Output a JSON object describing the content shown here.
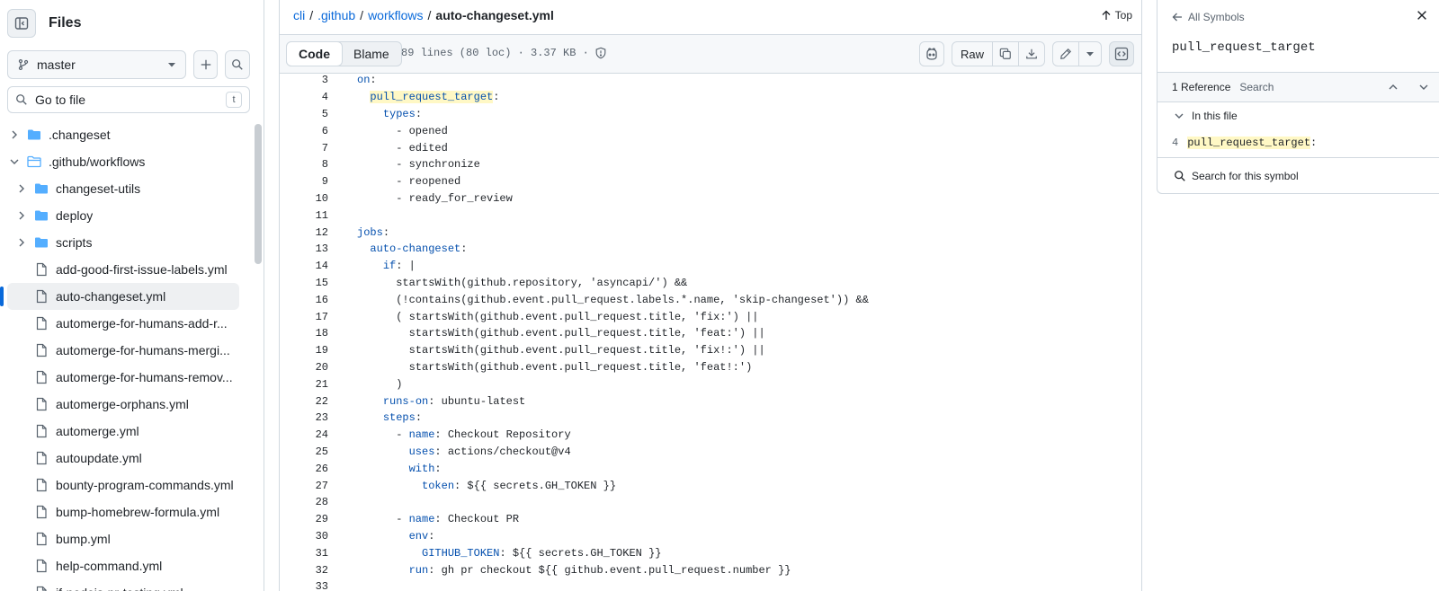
{
  "sidebar": {
    "title": "Files",
    "branch": "master",
    "goto_placeholder": "Go to file",
    "goto_shortcut": "t",
    "items": [
      {
        "label": ".changeset",
        "type": "folder",
        "expanded": false,
        "depth": 0
      },
      {
        "label": ".github/workflows",
        "type": "folder",
        "expanded": true,
        "depth": 0
      },
      {
        "label": "changeset-utils",
        "type": "folder",
        "expanded": false,
        "depth": 1
      },
      {
        "label": "deploy",
        "type": "folder",
        "expanded": false,
        "depth": 1
      },
      {
        "label": "scripts",
        "type": "folder",
        "expanded": false,
        "depth": 1
      },
      {
        "label": "add-good-first-issue-labels.yml",
        "type": "file",
        "depth": 1
      },
      {
        "label": "auto-changeset.yml",
        "type": "file",
        "depth": 1,
        "active": true
      },
      {
        "label": "automerge-for-humans-add-r...",
        "type": "file",
        "depth": 1
      },
      {
        "label": "automerge-for-humans-mergi...",
        "type": "file",
        "depth": 1
      },
      {
        "label": "automerge-for-humans-remov...",
        "type": "file",
        "depth": 1
      },
      {
        "label": "automerge-orphans.yml",
        "type": "file",
        "depth": 1
      },
      {
        "label": "automerge.yml",
        "type": "file",
        "depth": 1
      },
      {
        "label": "autoupdate.yml",
        "type": "file",
        "depth": 1
      },
      {
        "label": "bounty-program-commands.yml",
        "type": "file",
        "depth": 1
      },
      {
        "label": "bump-homebrew-formula.yml",
        "type": "file",
        "depth": 1
      },
      {
        "label": "bump.yml",
        "type": "file",
        "depth": 1
      },
      {
        "label": "help-command.yml",
        "type": "file",
        "depth": 1
      },
      {
        "label": "if-nodejs-pr-testing.yml",
        "type": "file",
        "depth": 1
      }
    ]
  },
  "breadcrumb": {
    "repo": "cli",
    "sep": "/",
    "p1": ".github",
    "p2": "workflows",
    "file": "auto-changeset.yml"
  },
  "top_label": "Top",
  "toolbar": {
    "code_tab": "Code",
    "blame_tab": "Blame",
    "meta": "89 lines (80 loc) · 3.37 KB ·",
    "raw_label": "Raw"
  },
  "code_lines": [
    {
      "n": "3",
      "t": "on:"
    },
    {
      "n": "4",
      "t": "  pull_request_target:"
    },
    {
      "n": "5",
      "t": "    types:"
    },
    {
      "n": "6",
      "t": "      - opened"
    },
    {
      "n": "7",
      "t": "      - edited"
    },
    {
      "n": "8",
      "t": "      - synchronize"
    },
    {
      "n": "9",
      "t": "      - reopened"
    },
    {
      "n": "10",
      "t": "      - ready_for_review"
    },
    {
      "n": "11",
      "t": ""
    },
    {
      "n": "12",
      "t": "jobs:"
    },
    {
      "n": "13",
      "t": "  auto-changeset:"
    },
    {
      "n": "14",
      "t": "    if: |"
    },
    {
      "n": "15",
      "t": "      startsWith(github.repository, 'asyncapi/') &&"
    },
    {
      "n": "16",
      "t": "      (!contains(github.event.pull_request.labels.*.name, 'skip-changeset')) &&"
    },
    {
      "n": "17",
      "t": "      ( startsWith(github.event.pull_request.title, 'fix:') ||"
    },
    {
      "n": "18",
      "t": "        startsWith(github.event.pull_request.title, 'feat:') ||"
    },
    {
      "n": "19",
      "t": "        startsWith(github.event.pull_request.title, 'fix!:') ||"
    },
    {
      "n": "20",
      "t": "        startsWith(github.event.pull_request.title, 'feat!:')"
    },
    {
      "n": "21",
      "t": "      )"
    },
    {
      "n": "22",
      "t": "    runs-on: ubuntu-latest"
    },
    {
      "n": "23",
      "t": "    steps:"
    },
    {
      "n": "24",
      "t": "      - name: Checkout Repository"
    },
    {
      "n": "25",
      "t": "        uses: actions/checkout@v4"
    },
    {
      "n": "26",
      "t": "        with:"
    },
    {
      "n": "27",
      "t": "          token: ${{ secrets.GH_TOKEN }}"
    },
    {
      "n": "28",
      "t": ""
    },
    {
      "n": "29",
      "t": "      - name: Checkout PR"
    },
    {
      "n": "30",
      "t": "        env:"
    },
    {
      "n": "31",
      "t": "          GITHUB_TOKEN: ${{ secrets.GH_TOKEN }}"
    },
    {
      "n": "32",
      "t": "        run: gh pr checkout ${{ github.event.pull_request.number }}"
    },
    {
      "n": "33",
      "t": ""
    }
  ],
  "symbols": {
    "back_label": "All Symbols",
    "symbol_name": "pull_request_target",
    "ref_count": "1 Reference",
    "ref_search": "Search",
    "in_file": "In this file",
    "ref_line_num": "4",
    "ref_line_symbol": "pull_request_target",
    "ref_line_rest": ":",
    "search_symbol": "Search for this symbol"
  },
  "colors": {
    "accent": "#0969da",
    "keyword": "#0550ae",
    "highlight": "#fff8c5",
    "folder": "#54aeff"
  }
}
